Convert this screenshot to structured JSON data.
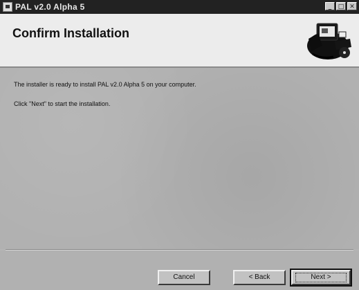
{
  "window": {
    "title": "PAL v2.0 Alpha 5"
  },
  "titlebar_buttons": {
    "minimize": "_",
    "maximize": "□",
    "close": "✕"
  },
  "header": {
    "title": "Confirm Installation",
    "logo_icon": "computer-setup-icon"
  },
  "content": {
    "line1": "The installer is ready to install PAL v2.0 Alpha 5 on your computer.",
    "line2": "Click \"Next\" to start the installation."
  },
  "buttons": {
    "cancel": "Cancel",
    "back": "< Back",
    "next": "Next >"
  }
}
